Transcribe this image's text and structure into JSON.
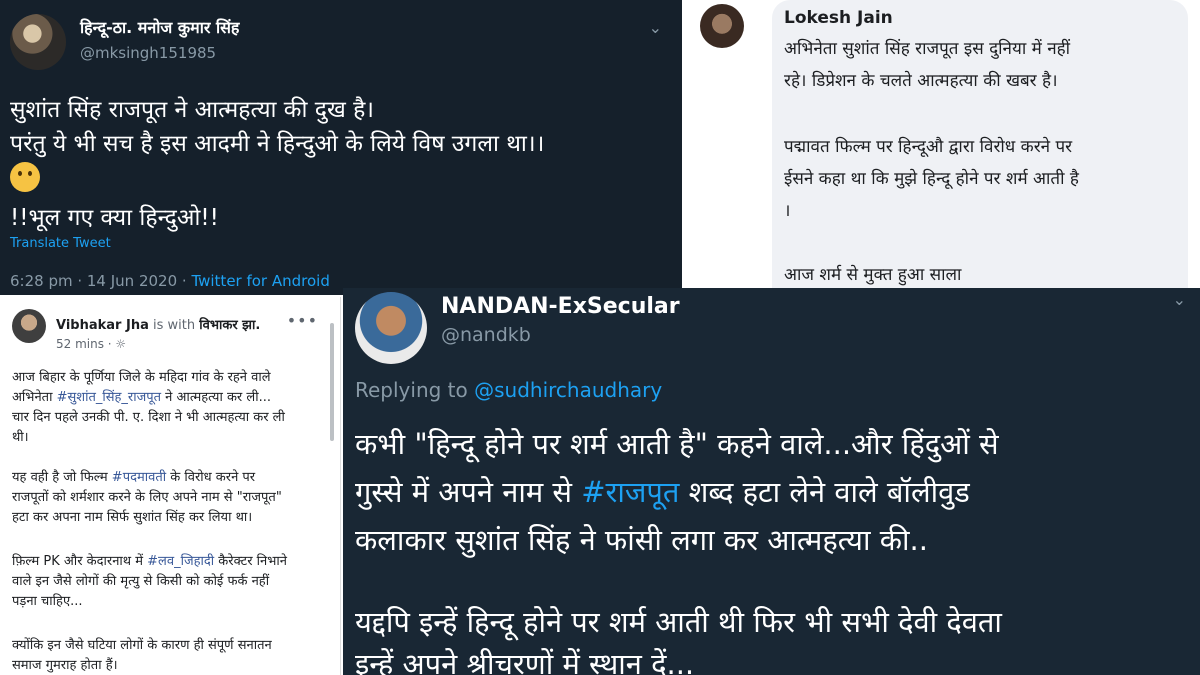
{
  "tweet1": {
    "display_name": "हिन्दू-ठा. मनोज कुमार सिंह",
    "handle": "@mksingh151985",
    "line1": "सुशांत सिंह राजपूत ने आत्महत्या की दुख है।",
    "line2": "परंतु ये भी सच है इस आदमी ने हिन्दुओ के लिये विष उगला था।।",
    "emoji": "thinking-face",
    "line3": "!!भूल गए क्या हिन्दुओ!!",
    "translate": "Translate Tweet",
    "time": "6:28 pm · 14 Jun 2020 · ",
    "source": "Twitter for Android"
  },
  "comment": {
    "name": "Lokesh Jain",
    "line1": "अभिनेता सुशांत सिंह राजपूत इस दुनिया में नहीं",
    "line2": "रहे। डिप्रेशन के चलते आत्महत्या की खबर है।",
    "line3": "पद्मावत फिल्म पर हिन्दूऔ द्वारा विरोध करने पर",
    "line4": "ईसने कहा था कि मुझे हिन्दू होने पर शर्म आती है",
    "line5": "।",
    "line6": "आज शर्म से मुक्त हुआ साला"
  },
  "fbpost": {
    "author": "Vibhakar Jha",
    "is_with": "is with",
    "with_name": "विभाकर झा.",
    "time": "52 mins · ",
    "menu": "•••",
    "p1_l1": "आज बिहार के पूर्णिया जिले के महिदा गांव के रहने वाले",
    "p1_l2_a": "अभिनेता ",
    "p1_l2_tag": "#सुशांत_सिंह_राजपूत",
    "p1_l2_b": " ने आत्महत्या कर ली...",
    "p1_l3": "चार दिन पहले उनकी पी. ए. दिशा ने भी आत्महत्या कर ली",
    "p1_l4": "थी।",
    "p2_l1_a": "यह वही है जो फिल्म ",
    "p2_l1_tag": "#पदमावती",
    "p2_l1_b": " के विरोध करने पर",
    "p2_l2": "राजपूतों को शर्मशार करने के लिए अपने नाम से \"राजपूत\"",
    "p2_l3": "हटा कर अपना नाम सिर्फ सुशांत सिंह कर लिया था।",
    "p3_l1_a": "फ़िल्म PK और केदारनाथ में ",
    "p3_l1_tag": "#लव_जिहादी",
    "p3_l1_b": " कैरेक्टर निभाने",
    "p3_l2": "वाले इन जैसे लोगों की मृत्यु से किसी को कोई फर्क नहीं",
    "p3_l3": "पड़ना चाहिए...",
    "p4_l1": "क्योंकि इन जैसे घटिया लोगों के कारण ही संपूर्ण सनातन",
    "p4_l2": "समाज गुमराह होता हैं।"
  },
  "tweet2": {
    "display_name": "NANDAN-ExSecular",
    "handle": "@nandkb",
    "replying_to": "Replying to ",
    "mention": "@sudhirchaudhary",
    "l1": "कभी \"हिन्दू होने पर शर्म आती है\" कहने वाले...और हिंदुओं से",
    "l2_a": "गुस्से में अपने नाम से ",
    "l2_tag": "#राजपूत",
    "l2_b": " शब्द हटा लेने वाले बॉलीवुड",
    "l3": "कलाकार सुशांत सिंह ने फांसी लगा कर आत्महत्या की..",
    "l4": "यद्दपि इन्हें हिन्दू होने पर शर्म आती थी फिर भी सभी देवी देवता",
    "l5": "इन्हें अपने श्रीचरणों में स्थान दें..."
  },
  "colors": {
    "dark_bg": "#15202b",
    "dark_bg2": "#192734",
    "link_blue": "#1da1f2",
    "muted": "#8899a6",
    "fb_link": "#385898"
  }
}
